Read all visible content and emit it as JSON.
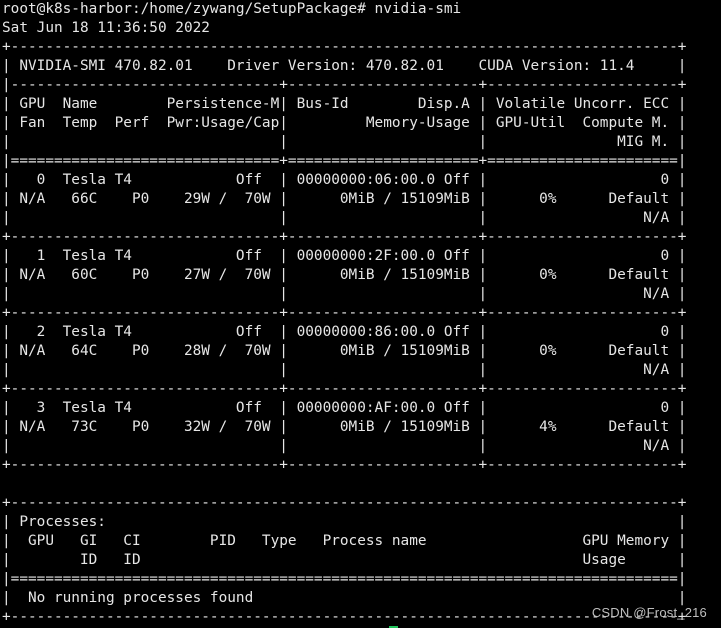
{
  "terminal": {
    "lines": [
      "root@k8s-harbor:/home/zywang/SetupPackage# nvidia-smi",
      "Sat Jun 18 11:36:50 2022",
      "+-----------------------------------------------------------------------------+",
      "| NVIDIA-SMI 470.82.01    Driver Version: 470.82.01    CUDA Version: 11.4     |",
      "|-------------------------------+----------------------+----------------------+",
      "| GPU  Name        Persistence-M| Bus-Id        Disp.A | Volatile Uncorr. ECC |",
      "| Fan  Temp  Perf  Pwr:Usage/Cap|         Memory-Usage | GPU-Util  Compute M. |",
      "|                               |                      |               MIG M. |",
      "|===============================+======================+======================|",
      "|   0  Tesla T4            Off  | 00000000:06:00.0 Off |                    0 |",
      "| N/A   66C    P0    29W /  70W |      0MiB / 15109MiB |      0%      Default |",
      "|                               |                      |                  N/A |",
      "+-------------------------------+----------------------+----------------------+",
      "|   1  Tesla T4            Off  | 00000000:2F:00.0 Off |                    0 |",
      "| N/A   60C    P0    27W /  70W |      0MiB / 15109MiB |      0%      Default |",
      "|                               |                      |                  N/A |",
      "+-------------------------------+----------------------+----------------------+",
      "|   2  Tesla T4            Off  | 00000000:86:00.0 Off |                    0 |",
      "| N/A   64C    P0    28W /  70W |      0MiB / 15109MiB |      0%      Default |",
      "|                               |                      |                  N/A |",
      "+-------------------------------+----------------------+----------------------+",
      "|   3  Tesla T4            Off  | 00000000:AF:00.0 Off |                    0 |",
      "| N/A   73C    P0    32W /  70W |      0MiB / 15109MiB |      4%      Default |",
      "|                               |                      |                  N/A |",
      "+-------------------------------+----------------------+----------------------+",
      "",
      "+-----------------------------------------------------------------------------+",
      "| Processes:                                                                  |",
      "|  GPU   GI   CI        PID   Type   Process name                  GPU Memory |",
      "|        ID   ID                                                   Usage      |",
      "|=============================================================================|",
      "|  No running processes found                                                 |",
      "+-----------------------------------------------------------------------------+"
    ]
  },
  "watermark": "CSDN @Frost_216",
  "colors": {
    "background": "#000000",
    "text": "#e6e6e6",
    "cursor": "#21c45b"
  }
}
